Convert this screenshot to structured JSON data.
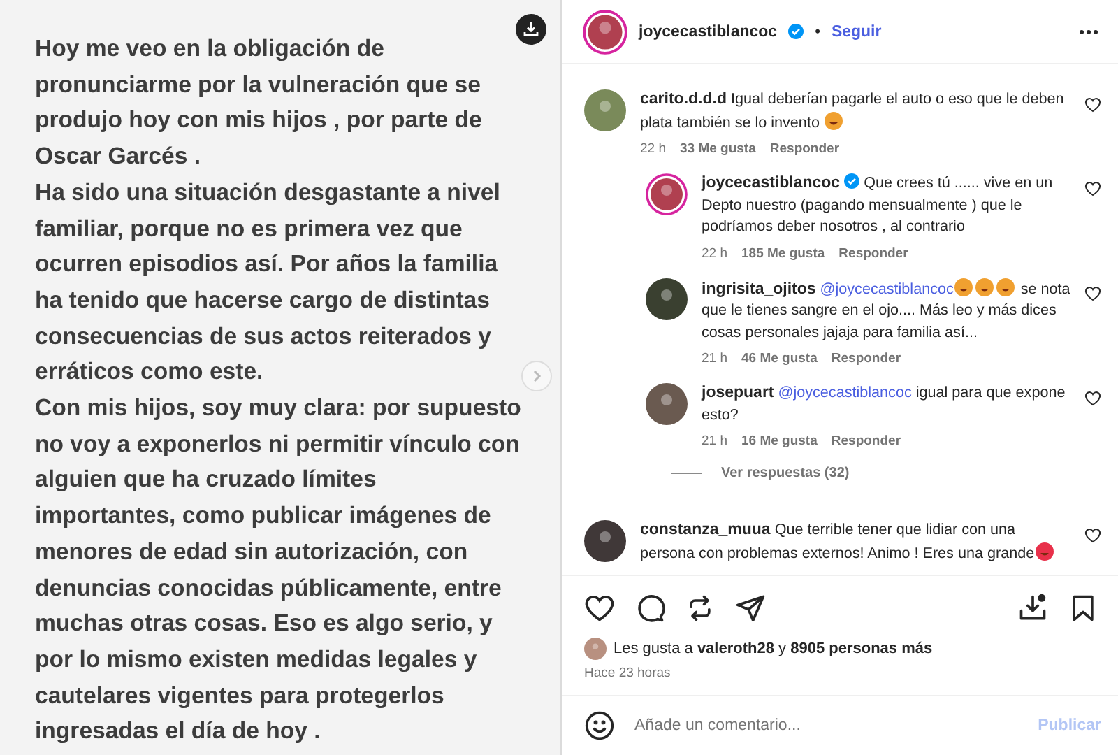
{
  "post_image": {
    "lines": [
      "Hoy me veo en la obligación de",
      "pronunciarme por la vulneración que se",
      "produjo hoy con mis hijos , por parte de",
      "Oscar Garcés .",
      "Ha sido una situación desgastante a nivel",
      "familiar, porque no es primera vez que",
      "ocurren episodios así. Por años  la familia",
      "ha tenido que hacerse cargo de distintas",
      "consecuencias de sus actos reiterados y",
      "erráticos como este.",
      "Con mis hijos, soy muy clara: por supuesto",
      "no voy a exponerlos ni permitir vínculo con",
      "alguien que ha cruzado límites",
      "importantes, como publicar imágenes de",
      "menores de edad sin autorización, con",
      "denuncias conocidas públicamente, entre",
      "muchas otras cosas. Eso es algo serio, y",
      "por lo mismo existen medidas legales y",
      "cautelares vigentes para protegerlos",
      "ingresadas el día de hoy ."
    ]
  },
  "header": {
    "username": "joycecastiblancoc",
    "verified": true,
    "separator": "•",
    "follow": "Seguir"
  },
  "comments": [
    {
      "username": "carito.d.d.d",
      "verified": false,
      "parts": [
        {
          "kind": "text",
          "text": "Igual deberían pagarle el auto o eso que le deben plata también se lo invento "
        },
        {
          "kind": "emoji",
          "color": "#f0a030"
        }
      ],
      "time": "22 h",
      "likes": "33 Me gusta",
      "reply": "Responder",
      "replies": [
        {
          "username": "joycecastiblancoc",
          "verified": true,
          "parts": [
            {
              "kind": "text",
              "text": "Que crees tú ...... vive en un Depto nuestro (pagando mensualmente ) que le podríamos deber nosotros , al contrario"
            }
          ],
          "time": "22 h",
          "likes": "185 Me gusta",
          "reply": "Responder"
        },
        {
          "username": "ingrisita_ojitos",
          "verified": false,
          "parts": [
            {
              "kind": "mention",
              "text": "@joycecastiblancoc"
            },
            {
              "kind": "emoji",
              "color": "#f0a030"
            },
            {
              "kind": "emoji",
              "color": "#f0a030"
            },
            {
              "kind": "emoji",
              "color": "#f0a030"
            },
            {
              "kind": "text",
              "text": " se nota que le tienes sangre en el ojo.... Más leo y más dices cosas personales jajaja para familia así..."
            }
          ],
          "time": "21 h",
          "likes": "46 Me gusta",
          "reply": "Responder"
        },
        {
          "username": "josepuart",
          "verified": false,
          "parts": [
            {
              "kind": "mention",
              "text": "@joycecastiblancoc"
            },
            {
              "kind": "text",
              "text": " igual para que expone esto?"
            }
          ],
          "time": "21 h",
          "likes": "16 Me gusta",
          "reply": "Responder"
        }
      ],
      "view_replies": "Ver respuestas (32)"
    },
    {
      "username": "constanza_muua",
      "verified": false,
      "parts": [
        {
          "kind": "text",
          "text": "Que terrible tener que lidiar con una persona con problemas externos! Animo ! Eres una grande"
        },
        {
          "kind": "emoji",
          "color": "#e8304a"
        }
      ]
    }
  ],
  "likes": {
    "prefix": "Les gusta a ",
    "user": "valeroth28",
    "middle": " y ",
    "rest": "8905 personas más"
  },
  "time_ago": "Hace 23 horas",
  "comment_box": {
    "placeholder": "Añade un comentario...",
    "submit": "Publicar"
  }
}
